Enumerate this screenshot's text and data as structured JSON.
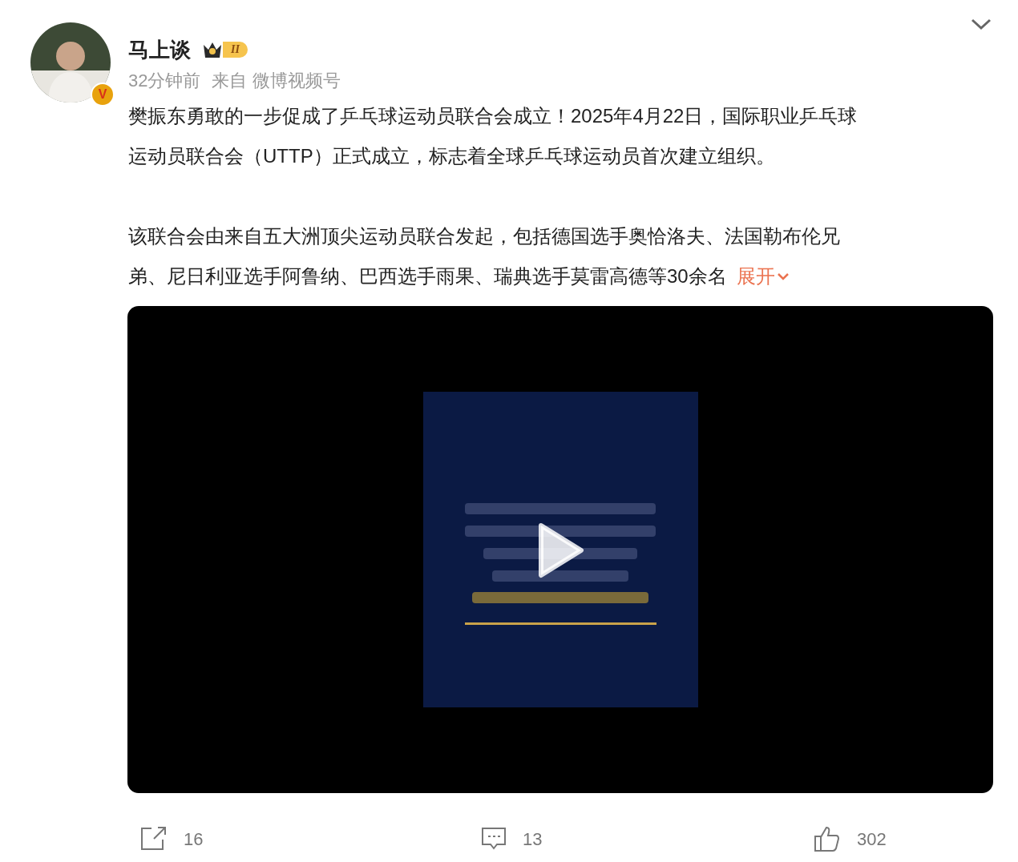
{
  "post": {
    "author": "马上谈",
    "level_badge": "II",
    "verified_mark": "V",
    "time": "32分钟前",
    "source": "来自 微博视频号",
    "paragraphs": [
      [
        "樊振东勇敢的一步促成了乒乓球运动员联合会成立！2025年4月22日，国际职业乒乓球",
        "运动员联合会（UTTP）正式成立，标志着全球乒乓球运动员首次建立组织。"
      ],
      [
        "该联合会由来自五大洲顶尖运动员联合发起，包括德国选手奥恰洛夫、法国勒布伦兄",
        "弟、尼日利亚选手阿鲁纳、巴西选手雨果、瑞典选手莫雷高德等30余名"
      ]
    ],
    "expand_link": "展开",
    "video": {
      "kind": "picture"
    },
    "actions": [
      {
        "kind": "share",
        "count": "16"
      },
      {
        "kind": "comment",
        "count": "13"
      },
      {
        "kind": "like",
        "count": "302"
      }
    ]
  }
}
